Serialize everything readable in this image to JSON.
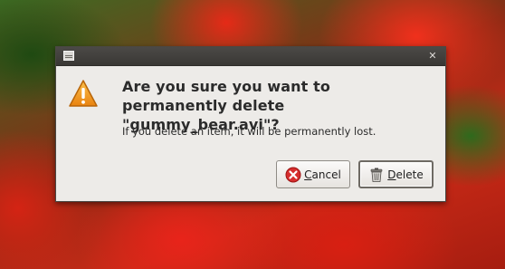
{
  "dialog": {
    "primary_text": "Are you sure you want to permanently delete \"gummy_bear.avi\"?",
    "secondary_text": "If you delete an item, it will be permanently lost.",
    "icons": {
      "window": "window-menu-icon",
      "close": "close-icon",
      "warning": "warning-icon"
    }
  },
  "buttons": {
    "cancel": {
      "label": "Cancel",
      "mnemonic": "C",
      "rest": "ancel",
      "icon": "cancel-icon"
    },
    "delete": {
      "label": "Delete",
      "mnemonic": "D",
      "rest": "elete",
      "icon": "trash-icon"
    }
  },
  "colors": {
    "dialog_bg": "#edebe8",
    "titlebar": "#3f3d3a",
    "warning": "#f29b1a",
    "cancel_icon": "#d62d2d"
  }
}
